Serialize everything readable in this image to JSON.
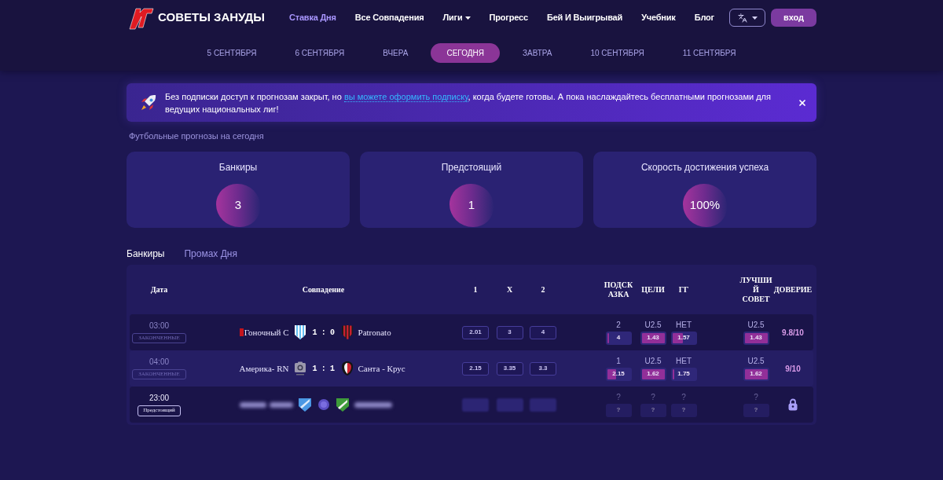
{
  "header": {
    "logo_text": "СОВЕТЫ ЗАНУДЫ",
    "nav": [
      {
        "label": "Ставка Дня",
        "selected": true,
        "dropdown": false
      },
      {
        "label": "Все Совпадения",
        "selected": false,
        "dropdown": false
      },
      {
        "label": "Лиги",
        "selected": false,
        "dropdown": true
      },
      {
        "label": "Прогресс",
        "selected": false,
        "dropdown": false
      },
      {
        "label": "Бей И Выигрывай",
        "selected": false,
        "dropdown": false
      },
      {
        "label": "Учебник",
        "selected": false,
        "dropdown": false
      },
      {
        "label": "Блог",
        "selected": false,
        "dropdown": false
      }
    ],
    "login_button": "вход"
  },
  "date_tabs": [
    {
      "label": "5 СЕНТЯБРЯ",
      "selected": false
    },
    {
      "label": "6 СЕНТЯБРЯ",
      "selected": false
    },
    {
      "label": "ВЧЕРА",
      "selected": false
    },
    {
      "label": "СЕГОДНЯ",
      "selected": true
    },
    {
      "label": "ЗАВТРА",
      "selected": false
    },
    {
      "label": "10 СЕНТЯБРЯ",
      "selected": false
    },
    {
      "label": "11 СЕНТЯБРЯ",
      "selected": false
    }
  ],
  "banner": {
    "text_before": "Без подписки доступ к прогнозам закрыт, но",
    "link": "вы можете оформить подписку",
    "text_after": ", когда будете готовы. А пока наслаждайтесь бесплатными прогнозами для ведущих национальных лиг!"
  },
  "section_title": "Футбольные прогнозы на сегодня",
  "stats": [
    {
      "title": "Банкиры",
      "value": "3"
    },
    {
      "title": "Предстоящий",
      "value": "1"
    },
    {
      "title": "Скорость достижения успеха",
      "value": "100%"
    }
  ],
  "table_tabs": [
    {
      "label": "Банкиры",
      "selected": true
    },
    {
      "label": "Промах Дня",
      "selected": false
    }
  ],
  "table": {
    "columns": [
      "Дата",
      "Совпадение",
      "1",
      "X",
      "2",
      "ПОДСКАЗКА",
      "ЦЕЛИ",
      "ГГ",
      "ЛУЧШИЙ СОВЕТ",
      "ДОВЕРИЕ"
    ],
    "rows": [
      {
        "time": "03:00",
        "status": {
          "kind": "finished",
          "label": "ЗАКОНЧЕННЫЕ"
        },
        "blurred": false,
        "home_flag": true,
        "home": "Гоночный С",
        "home_logo": {
          "kind": "stripes"
        },
        "score": "1 : 0",
        "away_logo": {
          "kind": "bars"
        },
        "away": "Patronato",
        "odds": [
          "2.01",
          "3",
          "4"
        ],
        "tip": {
          "pick": "2",
          "odds": "4",
          "level": 0.1
        },
        "goals": {
          "pick": "U2.5",
          "odds": "1.43",
          "level": 1
        },
        "gg": {
          "pick": "НЕТ",
          "odds": "1.57",
          "level": 0.45
        },
        "best": {
          "pick": "U2.5",
          "odds": "1.43",
          "level": 1
        },
        "locked": false,
        "confidence": "9.8/10"
      },
      {
        "time": "04:00",
        "status": {
          "kind": "finished",
          "label": "ЗАКОНЧЕННЫЕ"
        },
        "blurred": false,
        "home_flag": false,
        "home": "Америка- RN",
        "home_logo": {
          "kind": "photo"
        },
        "score": "1 : 1",
        "away_logo": {
          "kind": "crest"
        },
        "away": "Санта - Крус",
        "odds": [
          "2.15",
          "3.35",
          "3.3"
        ],
        "tip": {
          "pick": "1",
          "odds": "2.15",
          "level": 0.4
        },
        "goals": {
          "pick": "U2.5",
          "odds": "1.62",
          "level": 1
        },
        "gg": {
          "pick": "НЕТ",
          "odds": "1.75",
          "level": 0.1
        },
        "best": {
          "pick": "U2.5",
          "odds": "1.62",
          "level": 1
        },
        "locked": false,
        "confidence": "9/10"
      },
      {
        "time": "23:00",
        "status": {
          "kind": "upcoming",
          "label": "Предстоящий"
        },
        "blurred": true,
        "home_flag": false,
        "home_logo": {
          "kind": "shield"
        },
        "away_logo": {
          "kind": "badge"
        },
        "tip": {
          "pick": "?",
          "odds": "?"
        },
        "goals": {
          "pick": "?",
          "odds": "?"
        },
        "gg": {
          "pick": "?",
          "odds": "?"
        },
        "best": {
          "pick": "?",
          "odds": "?"
        },
        "locked": true
      }
    ]
  }
}
